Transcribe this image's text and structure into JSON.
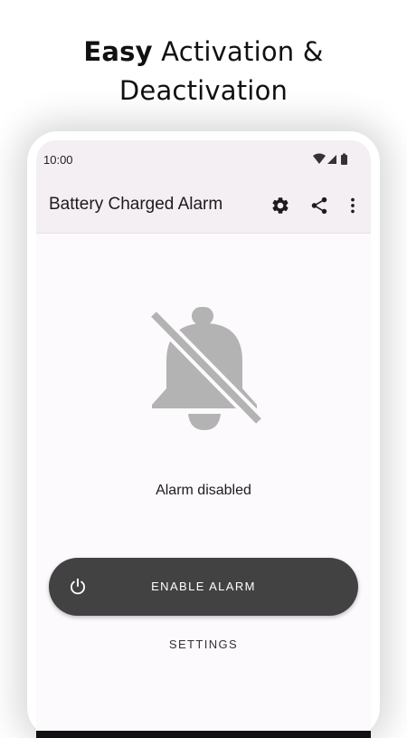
{
  "headline": {
    "bold_word": "Easy",
    "rest_line1": " Activation &",
    "line2": "Deactivation"
  },
  "status_bar": {
    "time": "10:00",
    "icons": [
      "wifi-icon",
      "cell-signal-icon",
      "battery-icon"
    ]
  },
  "app_bar": {
    "title": "Battery Charged Alarm",
    "actions": [
      "gear-icon",
      "share-icon",
      "more-vert-icon"
    ]
  },
  "main": {
    "status_icon": "bell-off-icon",
    "status_text": "Alarm disabled",
    "primary_button": {
      "icon": "power-icon",
      "label": "ENABLE ALARM"
    },
    "secondary_button": {
      "label": "SETTINGS"
    }
  },
  "colors": {
    "app_bar_bg": "#f3eff3",
    "screen_bg": "#fcfafc",
    "button_bg": "#424242",
    "icon_gray": "#b3b3b3"
  }
}
